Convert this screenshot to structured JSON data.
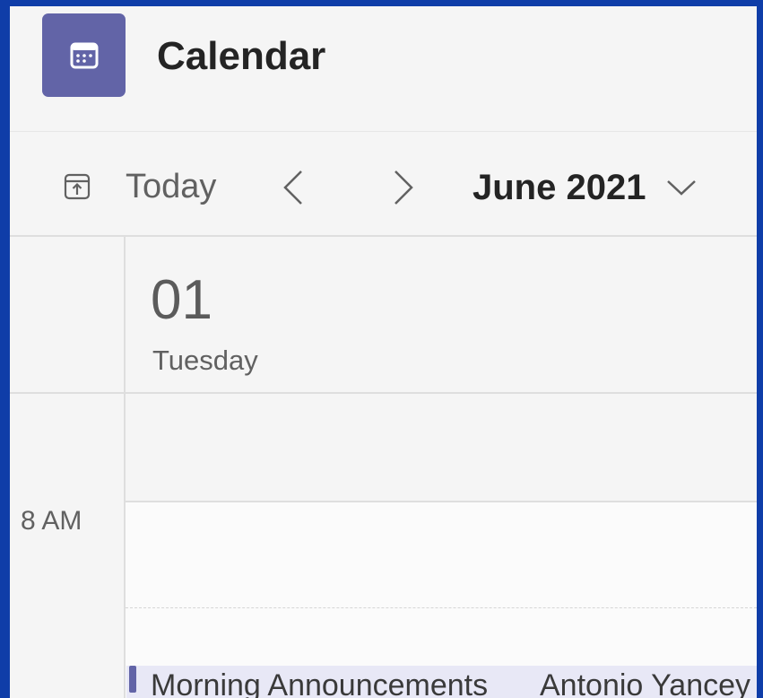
{
  "app": {
    "title": "Calendar",
    "accent_color": "#6264a7",
    "icon": "calendar-icon"
  },
  "toolbar": {
    "today_label": "Today",
    "today_icon": "calendar-today-icon",
    "prev_icon": "chevron-left-icon",
    "next_icon": "chevron-right-icon",
    "month_label": "June 2021",
    "month_chevron_icon": "chevron-down-icon"
  },
  "day": {
    "number": "01",
    "name": "Tuesday"
  },
  "time_slots": [
    "8 AM"
  ],
  "events": [
    {
      "title": "Morning Announcements",
      "organizer": "Antonio Yancey",
      "color": "#6264a7"
    }
  ]
}
